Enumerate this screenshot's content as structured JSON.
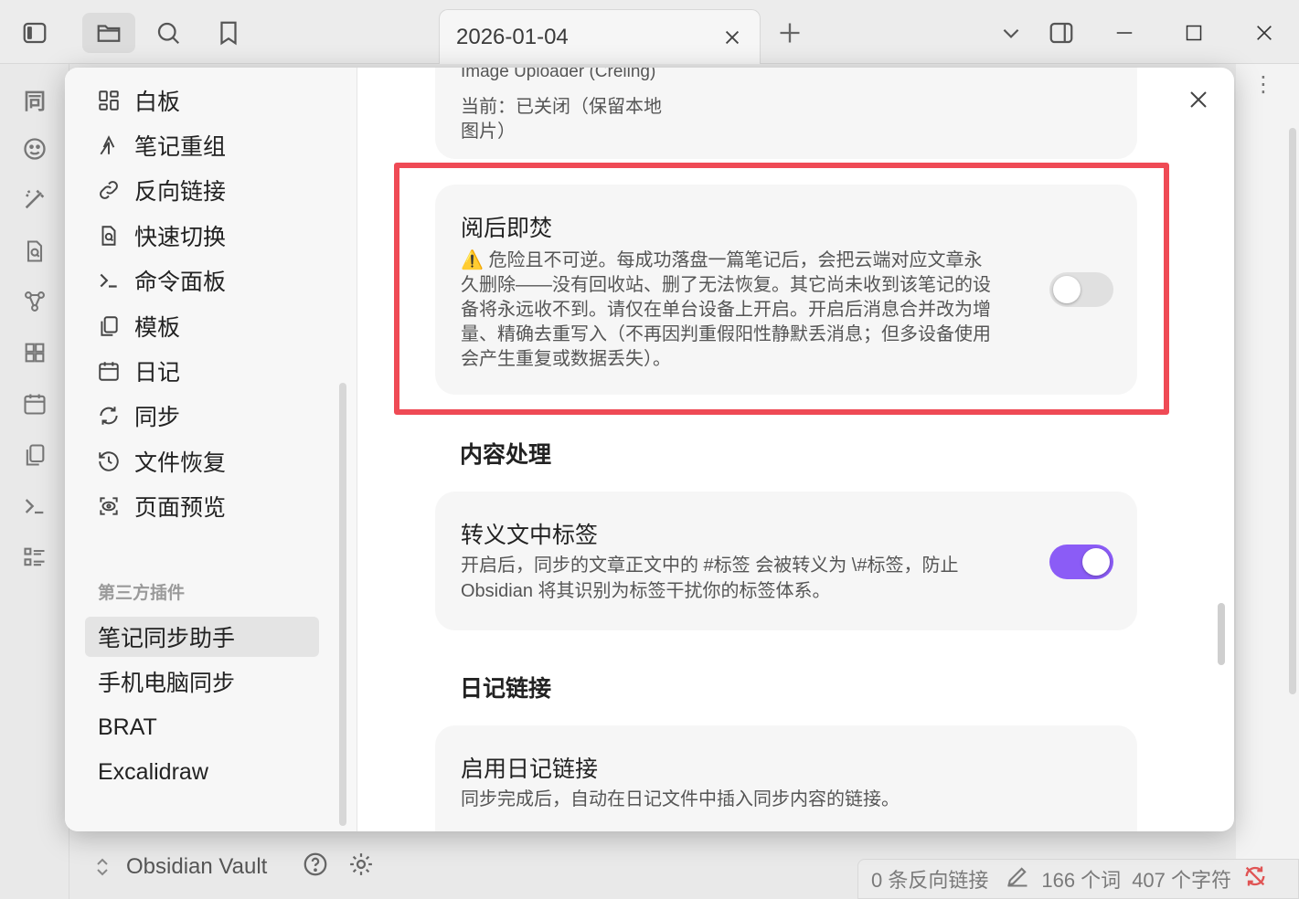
{
  "titlebar": {
    "tab_title": "2026-01-04"
  },
  "ribbon": {
    "icons": [
      "同",
      "emoji-icon",
      "magic-icon",
      "search-doc-icon",
      "graph-icon",
      "grid-icon",
      "calendar-icon",
      "copy-icon",
      "terminal-icon",
      "list-icon"
    ]
  },
  "settings": {
    "core_items": [
      {
        "label": "白板",
        "icon": "canvas-icon"
      },
      {
        "label": "笔记重组",
        "icon": "merge-icon"
      },
      {
        "label": "反向链接",
        "icon": "link-icon"
      },
      {
        "label": "快速切换",
        "icon": "file-search-icon"
      },
      {
        "label": "命令面板",
        "icon": "terminal-icon"
      },
      {
        "label": "模板",
        "icon": "copy-icon"
      },
      {
        "label": "日记",
        "icon": "calendar-icon"
      },
      {
        "label": "同步",
        "icon": "sync-icon"
      },
      {
        "label": "文件恢复",
        "icon": "history-icon"
      },
      {
        "label": "页面预览",
        "icon": "preview-icon"
      }
    ],
    "third_party_heading": "第三方插件",
    "plugins": [
      "笔记同步助手",
      "手机电脑同步",
      "BRAT",
      "Excalidraw"
    ],
    "selected_plugin": "笔记同步助手"
  },
  "content": {
    "top_card": {
      "title_partial": "Image Uploader (Creling)",
      "desc": "当前：已关闭（保留本地",
      "desc2": "图片）"
    },
    "burn_after_reading": {
      "title": "阅后即焚",
      "warning_icon": "⚠️",
      "line1": "危险且不可逆。每成功落盘一篇笔记后，会把云端对应文章永",
      "line2": "久删除——没有回收站、删了无法恢复。其它尚未收到该笔记的设",
      "line3": "备将永远收不到。请仅在单台设备上开启。开启后消息合并改为增",
      "line4": "量、精确去重写入（不再因判重假阳性静默丢消息；但多设备使用",
      "line5": "会产生重复或数据丢失）。",
      "enabled": false
    },
    "section_content": "内容处理",
    "escape_tags": {
      "title": "转义文中标签",
      "line1": "开启后，同步的文章正文中的 #标签 会被转义为 \\#标签，防止",
      "line2": "Obsidian 将其识别为标签干扰你的标签体系。",
      "enabled": true
    },
    "section_daily": "日记链接",
    "daily_link": {
      "title": "启用日记链接",
      "desc": "同步完成后，自动在日记文件中插入同步内容的链接。"
    }
  },
  "vault": {
    "name": "Obsidian Vault"
  },
  "statusbar": {
    "backlinks": "0 条反向链接",
    "words": "166 个词",
    "chars": "407 个字符"
  },
  "colors": {
    "accent": "#8b5cf6",
    "highlight": "#ef4a55"
  }
}
